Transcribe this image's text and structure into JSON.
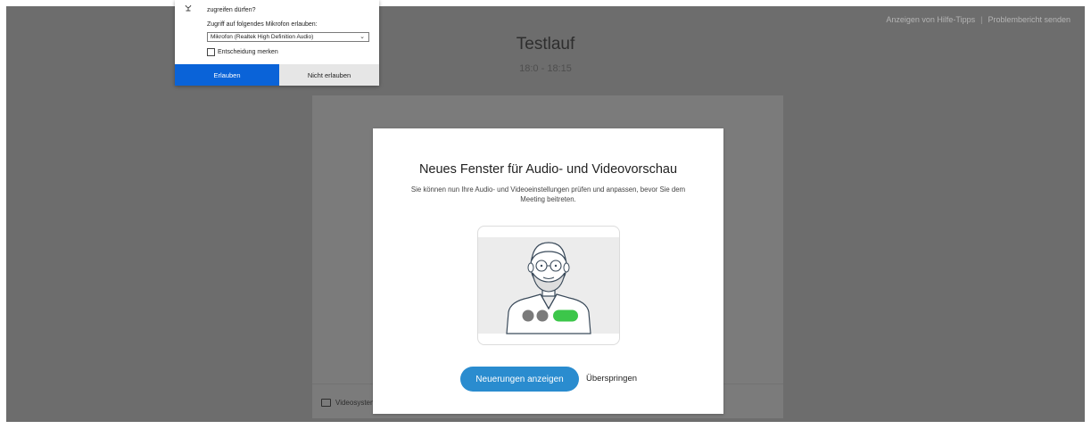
{
  "header": {
    "help_tips_link": "Anzeigen von Hilfe-Tipps",
    "separator": "|",
    "problem_report_link": "Problembericht senden"
  },
  "meeting": {
    "title": "Testlauf",
    "time": "18:0 - 18:15"
  },
  "panel": {
    "video_system_label": "Videosystem"
  },
  "modal": {
    "title": "Neues Fenster für Audio- und Videovorschau",
    "description": "Sie können nun Ihre Audio- und Videoeinstellungen prüfen und anpassen, bevor Sie dem Meeting beitreten.",
    "primary_button": "Neuerungen anzeigen",
    "skip_link": "Überspringen"
  },
  "permission": {
    "question": "zugreifen dürfen?",
    "label": "Zugriff auf folgendes Mikrofon erlauben:",
    "selected_device": "Mikrofon (Realtek High Definition Audio)",
    "remember_label": "Entscheidung merken",
    "allow_button": "Erlauben",
    "deny_button": "Nicht erlauben"
  },
  "colors": {
    "overlay": "#6d6d6d",
    "primary": "#2a8ccf",
    "allow": "#0a63d8",
    "green_toggle": "#3cc64a",
    "grey_dot": "#7a7a7a"
  }
}
